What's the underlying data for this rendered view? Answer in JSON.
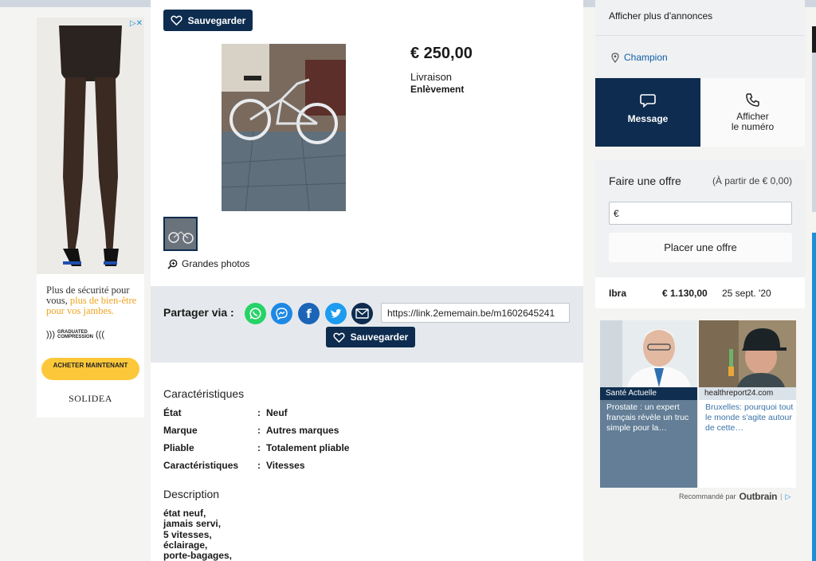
{
  "ad": {
    "text_pre": "Plus de sécurité pour vous, ",
    "text_highlight": "plus de bien-être pour vos jambes.",
    "badge": "GRADUATED COMPRESSION",
    "cta": "ACHETER MAINTENANT",
    "brand": "SOLIDEA"
  },
  "listing": {
    "save_label": "Sauvegarder",
    "price": "€ 250,00",
    "delivery_label": "Livraison",
    "delivery_value": "Enlèvement",
    "big_photos": "Grandes photos"
  },
  "share": {
    "label": "Partager via :",
    "link": "https://link.2ememain.be/m1602645241",
    "save_label": "Sauvegarder"
  },
  "specs": {
    "title": "Caractéristiques",
    "separator": ":",
    "rows": [
      {
        "key": "État",
        "value": "Neuf"
      },
      {
        "key": "Marque",
        "value": "Autres marques"
      },
      {
        "key": "Pliable",
        "value": "Totalement pliable"
      },
      {
        "key": "Caractéristiques",
        "value": "Vitesses"
      }
    ]
  },
  "description": {
    "title": "Description",
    "lines": [
      "état neuf,",
      "jamais servi,",
      "5 vitesses,",
      "éclairage,",
      "porte-bagages,"
    ]
  },
  "seller": {
    "more_ads": "Afficher plus d'annonces",
    "location": "Champion",
    "message": "Message",
    "show_number_line1": "Afficher",
    "show_number_line2": "le numéro"
  },
  "offer": {
    "title": "Faire une offre",
    "from": "(À partir de € 0,00)",
    "currency": "€",
    "button": "Placer une offre"
  },
  "bid": {
    "name": "Ibra",
    "amount": "€ 1.130,00",
    "date": "25 sept. '20"
  },
  "outbrain": {
    "cards": [
      {
        "source": "Santé Actuelle",
        "title": "Prostate : un expert français révèle un truc simple pour la…"
      },
      {
        "source": "healthreport24.com",
        "title": "Bruxelles: pourquoi tout le monde s'agite autour de cette…"
      }
    ],
    "recommended": "Recommandé par",
    "brand": "Outbrain"
  },
  "colors": {
    "navy": "#0d2c4f",
    "link": "#0d5ea8",
    "whatsapp": "#25d366",
    "messenger": "#1e88e5",
    "facebook": "#1877f2",
    "twitter": "#1da1f2"
  }
}
